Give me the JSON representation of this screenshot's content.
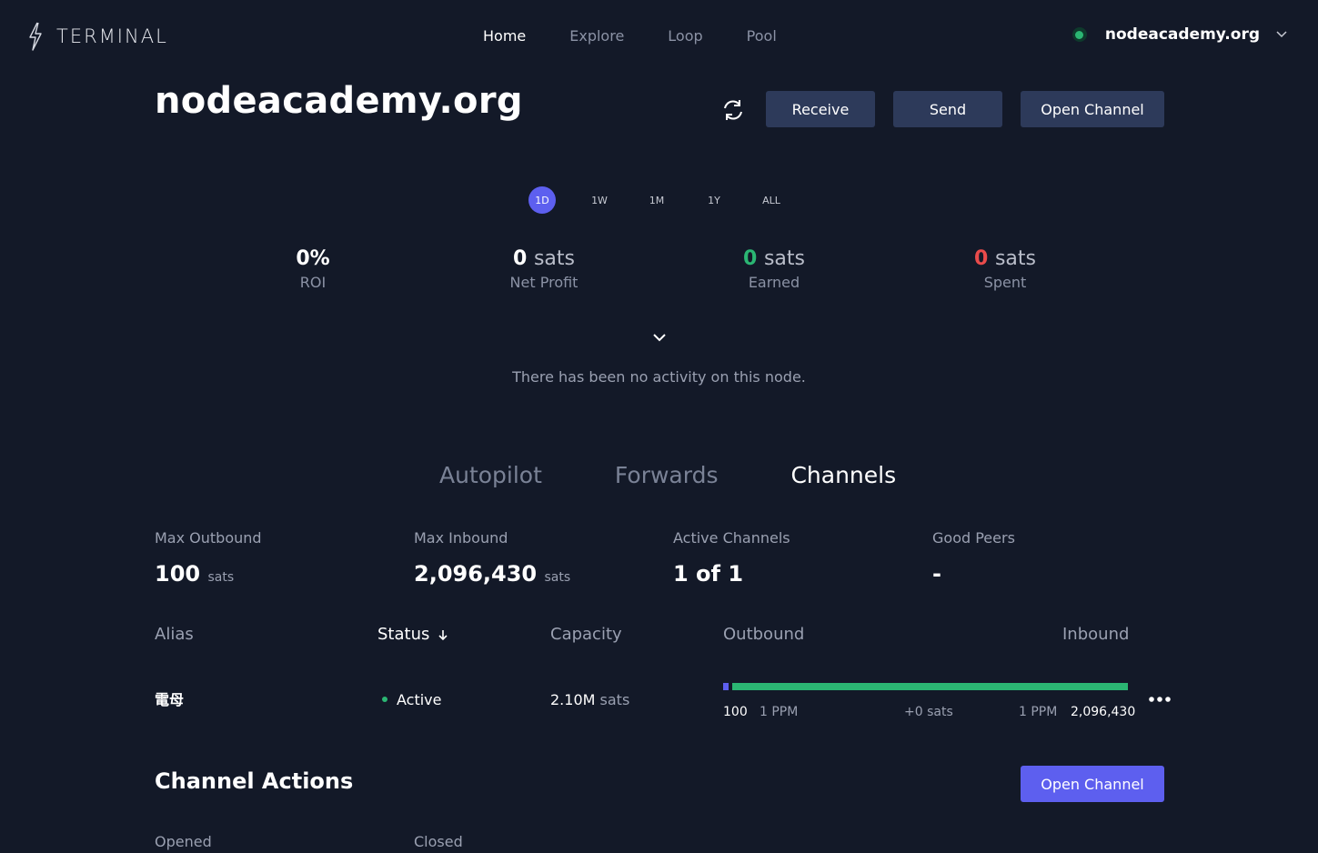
{
  "header": {
    "logo_text": "TERMINAL",
    "nav": [
      "Home",
      "Explore",
      "Loop",
      "Pool"
    ],
    "active_nav": "Home",
    "node_name": "nodeacademy.org",
    "status_color": "#2bb673"
  },
  "title": "nodeacademy.org",
  "actions": {
    "receive": "Receive",
    "send": "Send",
    "open_channel": "Open Channel"
  },
  "ranges": [
    "1D",
    "1W",
    "1M",
    "1Y",
    "ALL"
  ],
  "active_range": "1D",
  "stats": {
    "roi": {
      "value": "0%",
      "label": "ROI"
    },
    "net_profit": {
      "value": "0",
      "unit": "sats",
      "label": "Net Profit"
    },
    "earned": {
      "value": "0",
      "unit": "sats",
      "label": "Earned"
    },
    "spent": {
      "value": "0",
      "unit": "sats",
      "label": "Spent"
    }
  },
  "no_activity": "There has been no activity on this node.",
  "tabs": [
    "Autopilot",
    "Forwards",
    "Channels"
  ],
  "active_tab": "Channels",
  "summary": {
    "max_outbound": {
      "label": "Max Outbound",
      "value": "100",
      "unit": "sats"
    },
    "max_inbound": {
      "label": "Max Inbound",
      "value": "2,096,430",
      "unit": "sats"
    },
    "active_channels": {
      "label": "Active Channels",
      "value": "1 of 1"
    },
    "good_peers": {
      "label": "Good Peers",
      "value": "-"
    }
  },
  "table": {
    "headers": {
      "alias": "Alias",
      "status": "Status",
      "capacity": "Capacity",
      "outbound": "Outbound",
      "inbound": "Inbound"
    },
    "rows": [
      {
        "alias": "電母",
        "status": "Active",
        "capacity": "2.10M",
        "capacity_unit": "sats",
        "outbound": "100",
        "out_fee": "1 PPM",
        "balance": "+0 sats",
        "in_fee": "1 PPM",
        "inbound": "2,096,430",
        "outbound_fraction": 4.77e-05
      }
    ]
  },
  "channel_actions": {
    "title": "Channel Actions",
    "open_channel": "Open Channel",
    "opened": "Opened",
    "closed": "Closed"
  },
  "colors": {
    "background": "#131928",
    "accent": "#5d5fef",
    "button": "#2d3a5a",
    "positive": "#2bb673",
    "negative": "#e94b4b"
  }
}
